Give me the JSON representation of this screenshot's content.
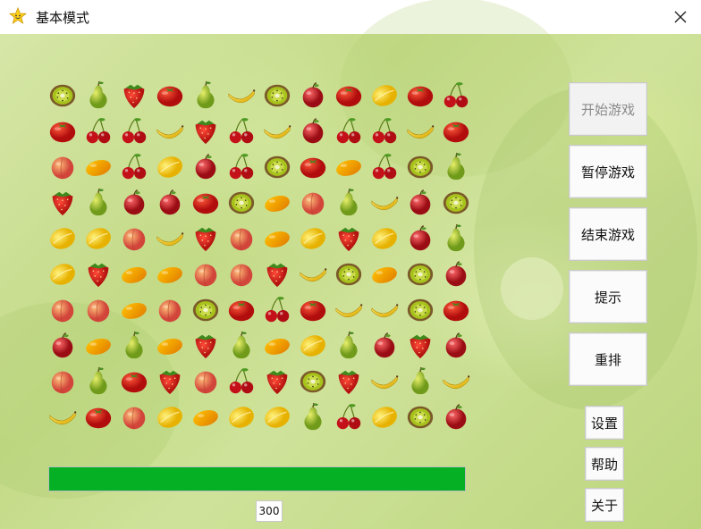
{
  "window": {
    "title": "基本模式",
    "app_icon": "star-smiley-icon",
    "close_icon": "close-icon"
  },
  "buttons": {
    "start": "开始游戏",
    "pause": "暂停游戏",
    "end": "结束游戏",
    "hint": "提示",
    "reshuffle": "重排",
    "settings": "设置",
    "help": "帮助",
    "about": "关于"
  },
  "progress": {
    "fraction": 1.0,
    "color": "#06b025"
  },
  "score": "300",
  "colors": {
    "progress": "#06b025"
  },
  "board": {
    "rows": [
      [
        "kiwi",
        "pear",
        "strawberry",
        "tomato",
        "pear",
        "banana",
        "kiwi",
        "apple",
        "tomato",
        "lemon",
        "tomato",
        "cherry"
      ],
      [
        "tomato",
        "cherry",
        "cherry",
        "banana",
        "strawberry",
        "cherry",
        "banana",
        "apple",
        "cherry",
        "cherry",
        "banana",
        "tomato"
      ],
      [
        "peach",
        "mango",
        "cherry",
        "lemon",
        "apple",
        "cherry",
        "kiwi",
        "tomato",
        "mango",
        "cherry",
        "kiwi",
        "pear"
      ],
      [
        "strawberry",
        "pear",
        "apple",
        "apple",
        "tomato",
        "kiwi",
        "mango",
        "peach",
        "pear",
        "banana",
        "apple",
        "kiwi"
      ],
      [
        "lemon",
        "lemon",
        "peach",
        "banana",
        "strawberry",
        "peach",
        "mango",
        "lemon",
        "strawberry",
        "lemon",
        "apple",
        "pear"
      ],
      [
        "lemon",
        "strawberry",
        "mango",
        "mango",
        "peach",
        "peach",
        "strawberry",
        "banana",
        "kiwi",
        "mango",
        "kiwi",
        "apple"
      ],
      [
        "peach",
        "peach",
        "mango",
        "peach",
        "kiwi",
        "tomato",
        "cherry",
        "tomato",
        "banana",
        "banana",
        "kiwi",
        "tomato"
      ],
      [
        "apple",
        "mango",
        "pear",
        "mango",
        "strawberry",
        "pear",
        "mango",
        "lemon",
        "pear",
        "apple",
        "strawberry",
        "apple"
      ],
      [
        "peach",
        "pear",
        "tomato",
        "strawberry",
        "peach",
        "cherry",
        "strawberry",
        "kiwi",
        "strawberry",
        "banana",
        "pear",
        "banana"
      ],
      [
        "banana",
        "tomato",
        "peach",
        "lemon",
        "mango",
        "lemon",
        "lemon",
        "pear",
        "cherry",
        "lemon",
        "kiwi",
        "apple"
      ]
    ]
  }
}
